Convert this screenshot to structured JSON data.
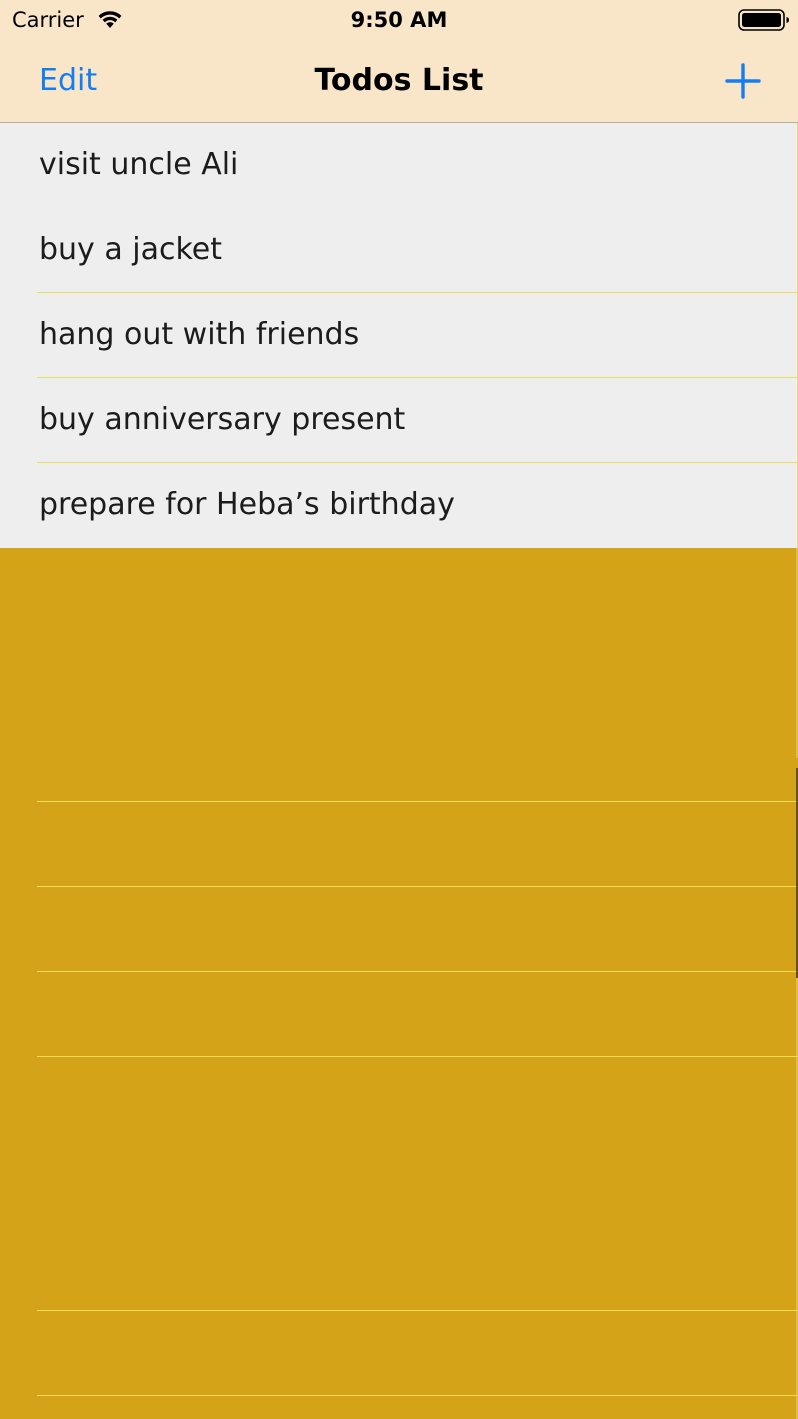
{
  "status_bar": {
    "carrier": "Carrier",
    "time": "9:50 AM",
    "wifi_icon": "wifi-icon",
    "battery_icon": "battery-full-icon"
  },
  "nav_bar": {
    "edit_label": "Edit",
    "title": "Todos List",
    "add_icon": "plus-icon",
    "background_color": "#f9e6c9",
    "accent_color": "#127ef5"
  },
  "todos": [
    "visit uncle Ali",
    "buy a jacket",
    "hang out with friends",
    "buy anniversary present",
    "prepare for Heba’s birthday"
  ],
  "colors": {
    "list_background": "#eeeeee",
    "empty_area_background": "#d4a317",
    "separator": "#e6de5c"
  }
}
